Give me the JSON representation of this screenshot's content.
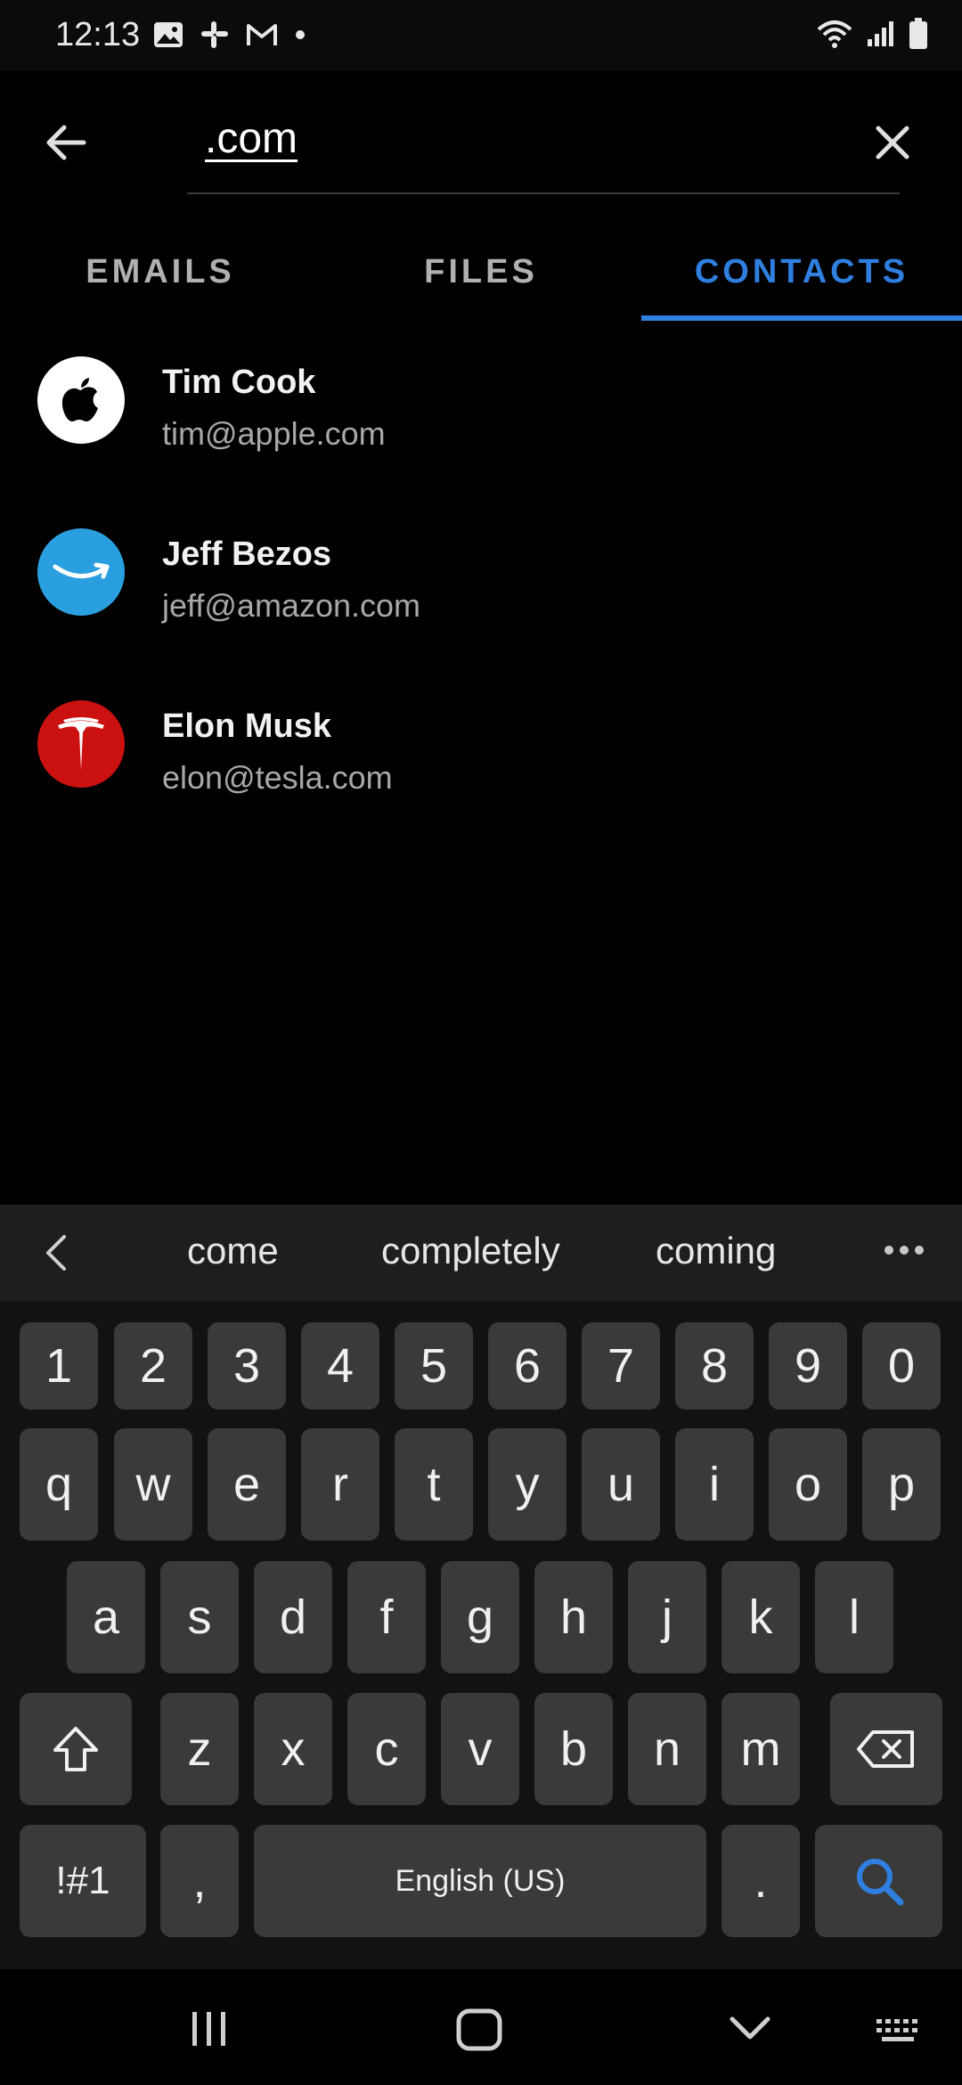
{
  "status_bar": {
    "time": "12:13"
  },
  "search": {
    "query": ".com"
  },
  "tabs": [
    {
      "label": "EMAILS",
      "active": false
    },
    {
      "label": "FILES",
      "active": false
    },
    {
      "label": "CONTACTS",
      "active": true
    }
  ],
  "contacts": [
    {
      "name": "Tim Cook",
      "email": "tim@apple.com",
      "avatar_icon": "apple-logo-icon",
      "avatar_color": "#ffffff"
    },
    {
      "name": "Jeff Bezos",
      "email": "jeff@amazon.com",
      "avatar_icon": "amazon-smile-icon",
      "avatar_color": "#2a9fe0"
    },
    {
      "name": "Elon Musk",
      "email": "elon@tesla.com",
      "avatar_icon": "tesla-logo-icon",
      "avatar_color": "#cc1111"
    }
  ],
  "suggestions": [
    "come",
    "completely",
    "coming"
  ],
  "keyboard": {
    "numbers": [
      "1",
      "2",
      "3",
      "4",
      "5",
      "6",
      "7",
      "8",
      "9",
      "0"
    ],
    "row1": [
      "q",
      "w",
      "e",
      "r",
      "t",
      "y",
      "u",
      "i",
      "o",
      "p"
    ],
    "row2": [
      "a",
      "s",
      "d",
      "f",
      "g",
      "h",
      "j",
      "k",
      "l"
    ],
    "row3": [
      "z",
      "x",
      "c",
      "v",
      "b",
      "n",
      "m"
    ],
    "symbols_label": "!#1",
    "comma_label": ",",
    "space_label": "English (US)",
    "period_label": "."
  },
  "colors": {
    "accent": "#2f7fe0",
    "background": "#000000",
    "key": "#3a3a3a"
  }
}
